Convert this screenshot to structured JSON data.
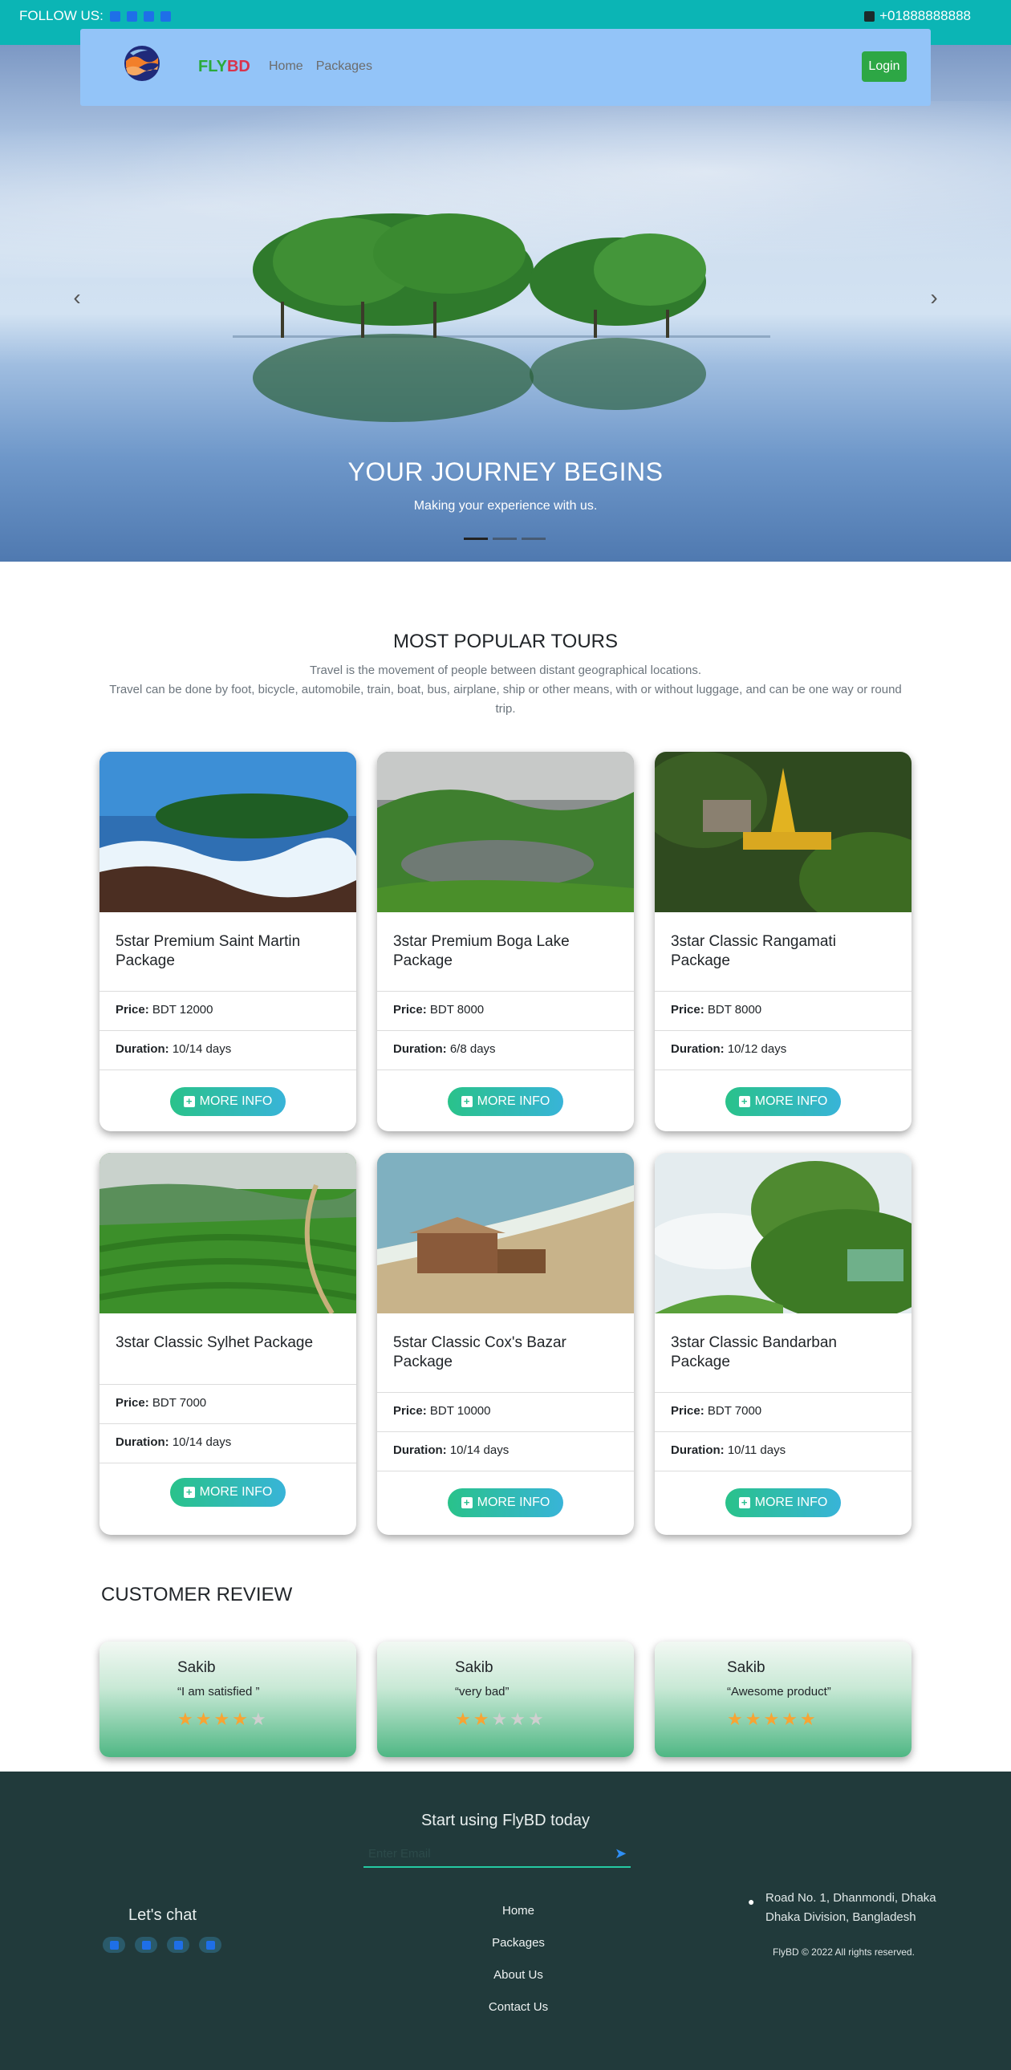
{
  "topbar": {
    "follow_label": "FOLLOW US:",
    "social_icons": [
      "facebook-icon",
      "twitter-icon",
      "youtube-icon",
      "vimeo-icon"
    ],
    "phone": "+01888888888"
  },
  "navbar": {
    "brand_fly": "FLY",
    "brand_bd": "BD",
    "links": [
      "Home",
      "Packages"
    ],
    "login_label": "Login"
  },
  "hero": {
    "title": "YOUR JOURNEY BEGINS",
    "subtitle": "Making your experience with us.",
    "slide_count": 3,
    "active_slide": 1
  },
  "popular": {
    "title": "MOST POPULAR TOURS",
    "desc_line1": "Travel is the movement of people between distant geographical locations.",
    "desc_line2": "Travel can be done by foot, bicycle, automobile, train, boat, bus, airplane, ship or other means, with or without luggage, and can be one way or round trip."
  },
  "packages": [
    {
      "title": "5star Premium Saint Martin Package",
      "price_label": "Price:",
      "price": "BDT 12000",
      "duration_label": "Duration:",
      "duration": "10/14 days",
      "button": "MORE INFO"
    },
    {
      "title": "3star Premium Boga Lake Package",
      "price_label": "Price:",
      "price": "BDT 8000",
      "duration_label": "Duration:",
      "duration": "6/8 days",
      "button": "MORE INFO"
    },
    {
      "title": "3star Classic Rangamati Package",
      "price_label": "Price:",
      "price": "BDT 8000",
      "duration_label": "Duration:",
      "duration": "10/12 days",
      "button": "MORE INFO"
    },
    {
      "title": "3star Classic Sylhet Package",
      "price_label": "Price:",
      "price": "BDT 7000",
      "duration_label": "Duration:",
      "duration": "10/14 days",
      "button": "MORE INFO"
    },
    {
      "title": "5star Classic Cox's Bazar Package",
      "price_label": "Price:",
      "price": "BDT 10000",
      "duration_label": "Duration:",
      "duration": "10/14 days",
      "button": "MORE INFO"
    },
    {
      "title": "3star Classic Bandarban Package",
      "price_label": "Price:",
      "price": "BDT 7000",
      "duration_label": "Duration:",
      "duration": "10/11 days",
      "button": "MORE INFO"
    }
  ],
  "reviews_title": "CUSTOMER REVIEW",
  "reviews": [
    {
      "name": "Sakib",
      "quote": "“I am satisfied ”",
      "rating": 4
    },
    {
      "name": "Sakib",
      "quote": "“very bad”",
      "rating": 2
    },
    {
      "name": "Sakib",
      "quote": "“Awesome product”",
      "rating": 5
    }
  ],
  "footer": {
    "cta": "Start using FlyBD today",
    "email_placeholder": "Enter Email",
    "chat_title": "Let's chat",
    "chat_icons": [
      "linkedin-icon",
      "twitter-icon",
      "youtube-icon",
      "facebook-icon"
    ],
    "links": [
      "Home",
      "Packages",
      "About Us",
      "Contact Us"
    ],
    "address_line1": "Road No. 1, Dhanmondi, Dhaka",
    "address_line2": "Dhaka Division, Bangladesh",
    "copyright": "FlyBD © 2022 All rights reserved."
  },
  "colors": {
    "topbar": "#0bb5b5",
    "navbar": "#93c4f8",
    "login": "#2da745",
    "footer": "#213a3b",
    "star_on": "#f7a434",
    "star_off": "#cfcfcf"
  }
}
